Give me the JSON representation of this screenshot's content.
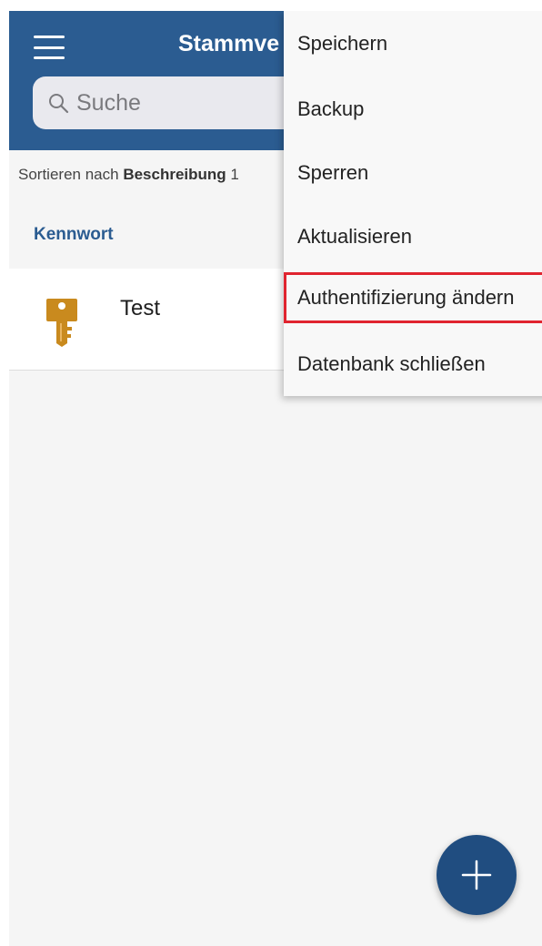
{
  "header": {
    "title": "Stammve",
    "menu_icon": "hamburger-icon",
    "background_color": "#2b5c91"
  },
  "search": {
    "placeholder": "Suche",
    "icon": "search-icon"
  },
  "sort": {
    "prefix": "Sortieren nach",
    "field": "Beschreibung",
    "suffix": "1"
  },
  "list": {
    "section_title": "Kennwort",
    "items": [
      {
        "name": "Test",
        "icon": "key-icon",
        "icon_color": "#c98a1e"
      }
    ]
  },
  "menu": {
    "items": [
      {
        "label": "Speichern",
        "highlighted": false
      },
      {
        "label": "Backup",
        "highlighted": false
      },
      {
        "label": "Sperren",
        "highlighted": false
      },
      {
        "label": "Aktualisieren",
        "highlighted": false
      },
      {
        "label": "Authentifizierung ändern",
        "highlighted": true
      },
      {
        "label": "Datenbank schließen",
        "highlighted": false
      }
    ],
    "highlight_color": "#e0242f"
  },
  "fab": {
    "icon": "plus-icon",
    "color": "#204d80"
  }
}
